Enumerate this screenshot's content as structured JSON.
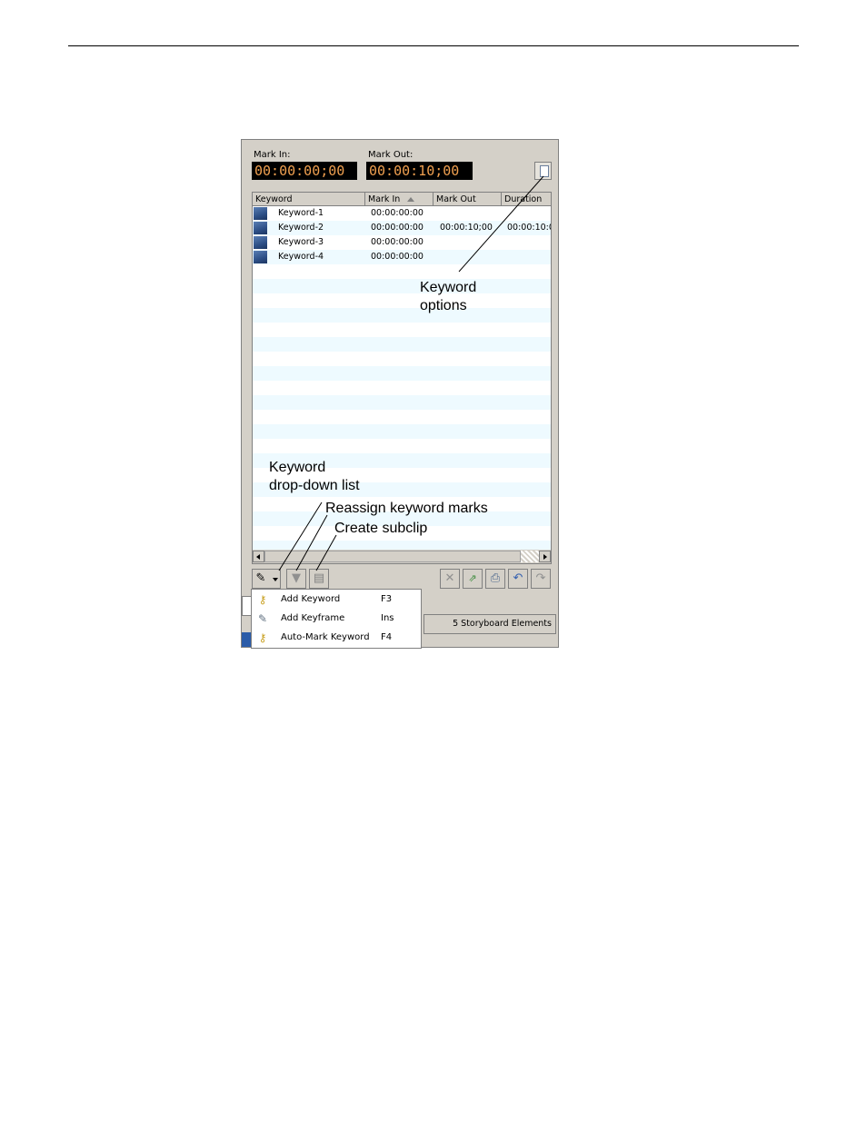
{
  "timecode": {
    "mark_in_label": "Mark In:",
    "mark_in_value": "00:00:00;00",
    "mark_out_label": "Mark Out:",
    "mark_out_value": "00:00:10;00"
  },
  "grid": {
    "columns": [
      "Keyword",
      "Mark In",
      "Mark Out",
      "Duration"
    ],
    "rows": [
      {
        "keyword": "Keyword-1",
        "mark_in": "00:00:00:00",
        "mark_out": "",
        "duration": ""
      },
      {
        "keyword": "Keyword-2",
        "mark_in": "00:00:00:00",
        "mark_out": "00:00:10;00",
        "duration": "00:00:10:0"
      },
      {
        "keyword": "Keyword-3",
        "mark_in": "00:00:00:00",
        "mark_out": "",
        "duration": ""
      },
      {
        "keyword": "Keyword-4",
        "mark_in": "00:00:00:00",
        "mark_out": "",
        "duration": ""
      }
    ]
  },
  "menu": {
    "items": [
      {
        "label": "Add Keyword",
        "shortcut": "F3",
        "icon": "key-icon"
      },
      {
        "label": "Add Keyframe",
        "shortcut": "Ins",
        "icon": "pushpin-icon"
      },
      {
        "label": "Auto-Mark Keyword",
        "shortcut": "F4",
        "icon": "auto-key-icon"
      }
    ]
  },
  "status": {
    "storyboard": "5 Storyboard Elements"
  },
  "callouts": {
    "keyword_options_1": "Keyword",
    "keyword_options_2": "options",
    "dropdown_1": "Keyword",
    "dropdown_2": "drop-down list",
    "reassign": "Reassign keyword marks",
    "subclip": "Create subclip"
  },
  "colors": {
    "timecode_text": "#f0a050",
    "row_alt": "#eefaff",
    "panel_bg": "#d4d0c8"
  }
}
